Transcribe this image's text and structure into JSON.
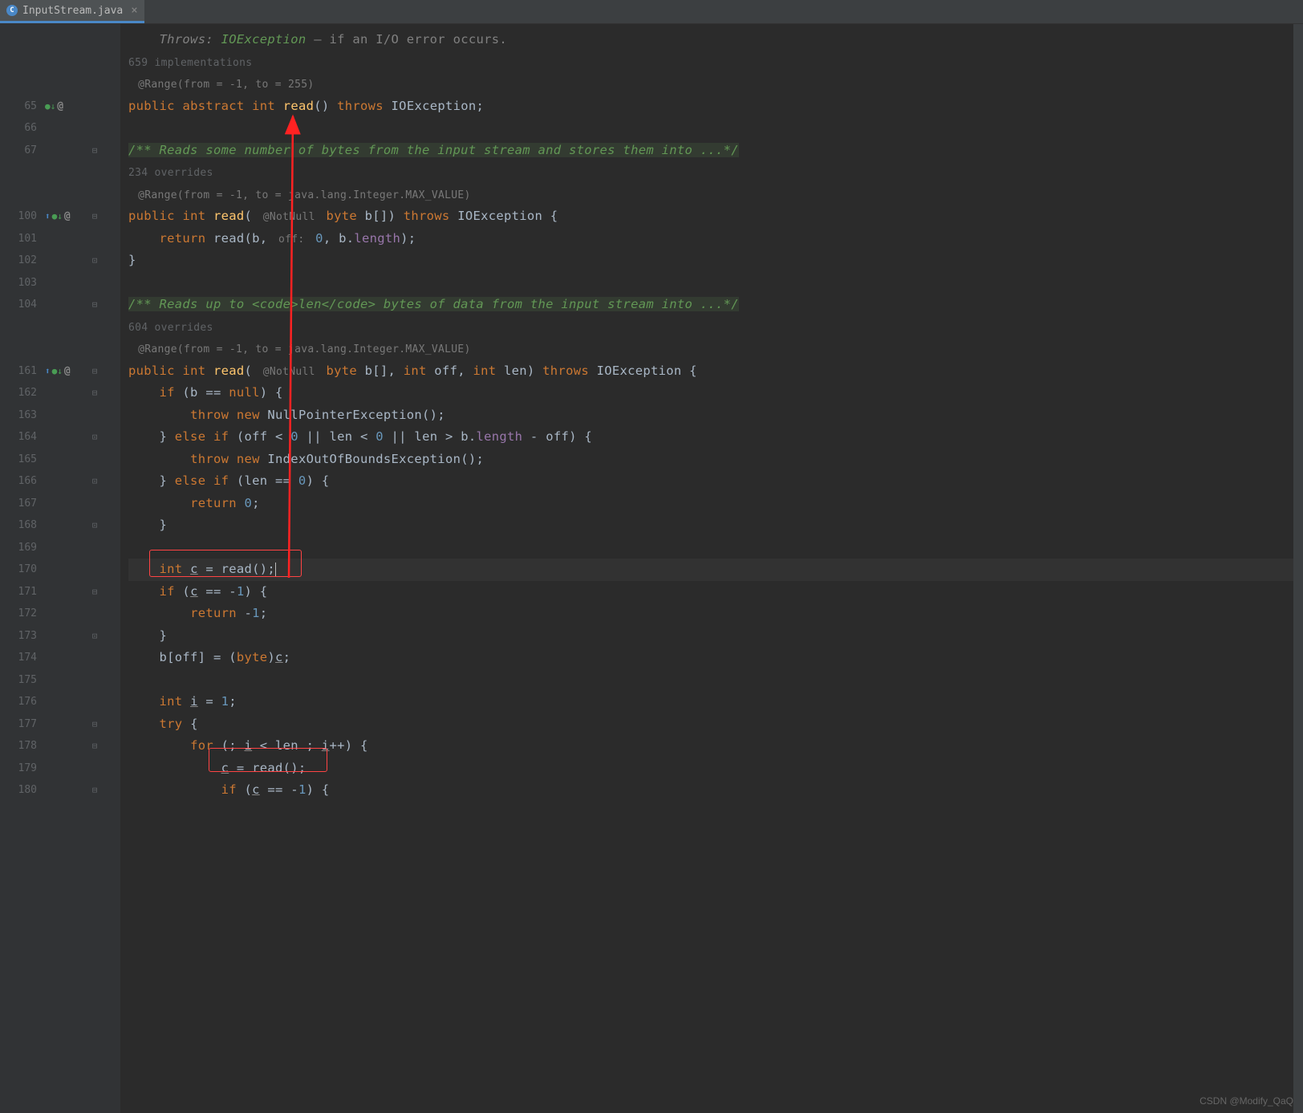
{
  "tab": {
    "filename": "InputStream.java"
  },
  "gutter": {
    "lines": [
      {
        "num": "",
        "icons": "",
        "fold": ""
      },
      {
        "num": "",
        "icons": "",
        "fold": ""
      },
      {
        "num": "",
        "icons": "",
        "fold": ""
      },
      {
        "num": "65",
        "icons": "impl-down,at",
        "fold": ""
      },
      {
        "num": "66",
        "icons": "",
        "fold": ""
      },
      {
        "num": "67",
        "icons": "",
        "fold": "⊟"
      },
      {
        "num": "",
        "icons": "",
        "fold": ""
      },
      {
        "num": "",
        "icons": "",
        "fold": ""
      },
      {
        "num": "100",
        "icons": "ov,impl-down,at",
        "fold": "⊟"
      },
      {
        "num": "101",
        "icons": "",
        "fold": ""
      },
      {
        "num": "102",
        "icons": "",
        "fold": "⊡"
      },
      {
        "num": "103",
        "icons": "",
        "fold": ""
      },
      {
        "num": "104",
        "icons": "",
        "fold": "⊟"
      },
      {
        "num": "",
        "icons": "",
        "fold": ""
      },
      {
        "num": "",
        "icons": "",
        "fold": ""
      },
      {
        "num": "161",
        "icons": "ov,impl-down,at",
        "fold": "⊟"
      },
      {
        "num": "162",
        "icons": "",
        "fold": "⊟"
      },
      {
        "num": "163",
        "icons": "",
        "fold": ""
      },
      {
        "num": "164",
        "icons": "",
        "fold": "⊡"
      },
      {
        "num": "165",
        "icons": "",
        "fold": ""
      },
      {
        "num": "166",
        "icons": "",
        "fold": "⊡"
      },
      {
        "num": "167",
        "icons": "",
        "fold": ""
      },
      {
        "num": "168",
        "icons": "",
        "fold": "⊡"
      },
      {
        "num": "169",
        "icons": "",
        "fold": ""
      },
      {
        "num": "170",
        "icons": "",
        "fold": ""
      },
      {
        "num": "171",
        "icons": "",
        "fold": "⊟"
      },
      {
        "num": "172",
        "icons": "",
        "fold": ""
      },
      {
        "num": "173",
        "icons": "",
        "fold": "⊡"
      },
      {
        "num": "174",
        "icons": "",
        "fold": ""
      },
      {
        "num": "175",
        "icons": "",
        "fold": ""
      },
      {
        "num": "176",
        "icons": "",
        "fold": ""
      },
      {
        "num": "177",
        "icons": "",
        "fold": "⊟"
      },
      {
        "num": "178",
        "icons": "",
        "fold": "⊟"
      },
      {
        "num": "179",
        "icons": "",
        "fold": ""
      },
      {
        "num": "180",
        "icons": "",
        "fold": "⊟"
      }
    ]
  },
  "code": {
    "throws_label": "Throws:",
    "ioexception_link": "IOException",
    "throws_rest": " – if an I/O error occurs.",
    "impl_659": "659 implementations",
    "range_255": " @Range(from = -1, to = 255) ",
    "doc_100": "/** Reads some number of bytes from the input stream and stores them into ...*/",
    "ov_234": "234 overrides",
    "range_max1": " @Range(from = -1, to = java.lang.Integer.MAX_VALUE) ",
    "doc_161": "/** Reads up to <code>len</code> bytes of data from the input stream into ...*/",
    "ov_604": "604 overrides",
    "range_max2": " @Range(from = -1, to = java.lang.Integer.MAX_VALUE) ",
    "notnull": "@NotNull",
    "off_inlay": "off:"
  },
  "watermark": "CSDN @Modify_QaQ"
}
